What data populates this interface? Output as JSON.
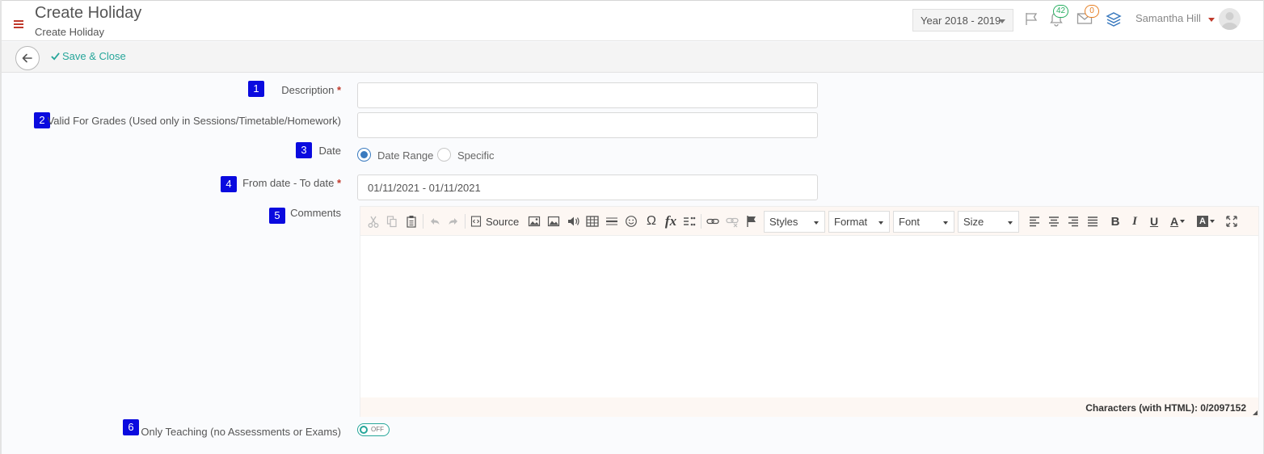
{
  "header": {
    "title": "Create Holiday",
    "subtitle": "Create Holiday",
    "year_select": "Year 2018 - 2019",
    "notifications_count": "42",
    "messages_count": "0",
    "user_name": "Samantha Hill",
    "colors": {
      "accent": "#26a69a",
      "menu": "#c0392b",
      "marker": "#0a0adf"
    }
  },
  "actions": {
    "save_close": "Save & Close"
  },
  "form": {
    "description": {
      "marker": "1",
      "label": "Description",
      "required": "*",
      "value": ""
    },
    "grades": {
      "marker": "2",
      "label": "Valid For Grades (Used only in Sessions/Timetable/Homework)",
      "value": ""
    },
    "date": {
      "marker": "3",
      "label": "Date",
      "options": [
        "Date Range",
        "Specific"
      ],
      "selected": "Date Range"
    },
    "date_range": {
      "marker": "4",
      "label": "From date - To date",
      "required": "*",
      "value": "01/11/2021 - 01/11/2021"
    },
    "comments": {
      "marker": "5",
      "label": "Comments"
    },
    "only_teaching": {
      "marker": "6",
      "label": "Only Teaching (no Assessments or Exams)",
      "toggle": "OFF"
    }
  },
  "editor": {
    "source_label": "Source",
    "styles": "Styles",
    "format": "Format",
    "font": "Font",
    "size": "Size",
    "formula_label": "fx",
    "omega_label": "Ω",
    "bold_label": "B",
    "italic_label": "I",
    "underline_label": "U",
    "text_color_label": "A",
    "bg_color_label": "A",
    "char_count": "Characters (with HTML): 0/2097152"
  }
}
